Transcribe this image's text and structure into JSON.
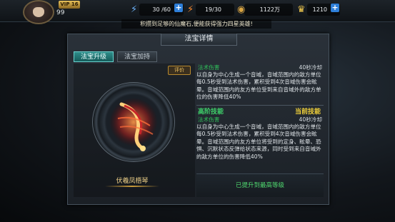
{
  "player": {
    "vip": "VIP 16",
    "level": "99"
  },
  "resources": [
    {
      "icon": "energy-icon",
      "value": "30 /60"
    },
    {
      "icon": "stamina-icon",
      "value": "19/30"
    },
    {
      "icon": "coin-icon",
      "value": "1122万"
    },
    {
      "icon": "gold-crown-icon",
      "value": "1210"
    }
  ],
  "notice": "积攒到足够的仙魔石,便能获得强力四星英雄!",
  "panel": {
    "title": "法宝详情",
    "tabs": [
      "法宝升级",
      "法宝加持"
    ],
    "rate_label": "评价",
    "item_name": "伏羲凤梧琴"
  },
  "current_skill": {
    "type": "法术伤害",
    "cooldown": "40秒冷却",
    "description": "以自身为中心生成一个音域，音域范围内的敌方单位每0.5秒受到法术伤害，累积受到4次音域伤害会眩晕。音域范围内的友方单位受到来自音域外的敌方单位的伤害降低40%"
  },
  "advanced_skill": {
    "head": "高阶技能",
    "current_label": "当前技能",
    "type": "法术伤害",
    "cooldown": "40秒冷却",
    "description": "以自身为中心生成一个音域，音域范围内的敌方单位每0.5秒受到法术伤害，累积受到4次音域伤害会眩晕。音域范围内的友方单位将受到的定身、眩晕、恐惧、沉默状态反弹给状态来源，同时受到来自音域外的敌方单位的伤害降低40%"
  },
  "max_level_text": "已提升到最高等级",
  "colors": {
    "accent_green": "#3fd36b",
    "gold": "#f1d38a",
    "tab_teal": "#2f8d8a"
  }
}
